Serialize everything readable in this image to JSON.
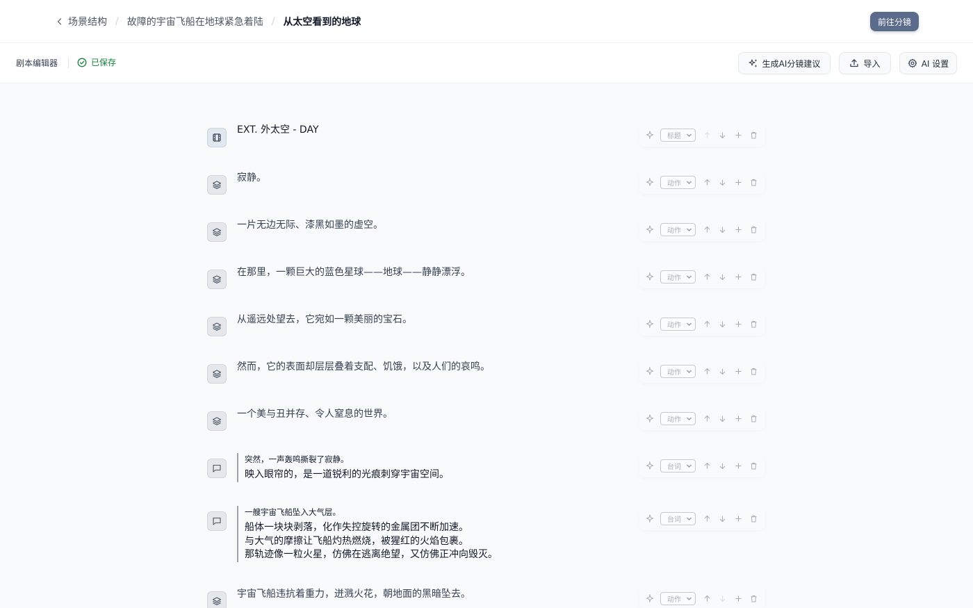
{
  "breadcrumb": {
    "items": [
      "场景结构",
      "故障的宇宙飞船在地球紧急着陆",
      "从太空看到的地球"
    ],
    "separator": "/"
  },
  "header": {
    "primary_button": "前往分镜"
  },
  "toolbar": {
    "editor_label": "剧本编辑器",
    "saved_label": "已保存",
    "ai_suggest_label": "生成AI分镜建议",
    "import_label": "导入",
    "ai_settings_label": "AI 设置"
  },
  "colors": {
    "primary": "#5b6b8c",
    "saved": "#15803d",
    "background": "#f8fafc"
  },
  "rows": [
    {
      "kind": "heading",
      "icon": "film-icon",
      "type": "标题",
      "text": "EXT. 外太空 - DAY"
    },
    {
      "kind": "action",
      "icon": "layers-icon",
      "type": "动作",
      "text": "寂静。"
    },
    {
      "kind": "action",
      "icon": "layers-icon",
      "type": "动作",
      "text": "一片无边无际、漆黑如墨的虚空。"
    },
    {
      "kind": "action",
      "icon": "layers-icon",
      "type": "动作",
      "text": "在那里，一颗巨大的蓝色星球——地球——静静漂浮。"
    },
    {
      "kind": "action",
      "icon": "layers-icon",
      "type": "动作",
      "text": "从遥远处望去，它宛如一颗美丽的宝石。"
    },
    {
      "kind": "action",
      "icon": "layers-icon",
      "type": "动作",
      "text": "然而，它的表面却层层叠着支配、饥饿，以及人们的哀鸣。"
    },
    {
      "kind": "action",
      "icon": "layers-icon",
      "type": "动作",
      "text": "一个美与丑并存、令人窒息的世界。"
    },
    {
      "kind": "dialogue",
      "icon": "message-icon",
      "type": "台词",
      "speaker": "突然，一声轰鸣撕裂了寂静。",
      "lines": [
        "映入眼帘的，是一道锐利的光痕刺穿宇宙空间。"
      ]
    },
    {
      "kind": "dialogue",
      "icon": "message-icon",
      "type": "台词",
      "speaker": "一艘宇宙飞船坠入大气层。",
      "lines": [
        "船体一块块剥落，化作失控旋转的金属团不断加速。",
        "与大气的摩擦让飞船灼热燃烧，被猩红的火焰包裹。",
        "那轨迹像一粒火星，仿佛在逃离绝望，又仿佛正冲向毁灭。"
      ]
    },
    {
      "kind": "action",
      "icon": "layers-icon",
      "type": "动作",
      "text": "宇宙飞船违抗着重力，迸溅火花，朝地面的黑暗坠去。"
    }
  ]
}
